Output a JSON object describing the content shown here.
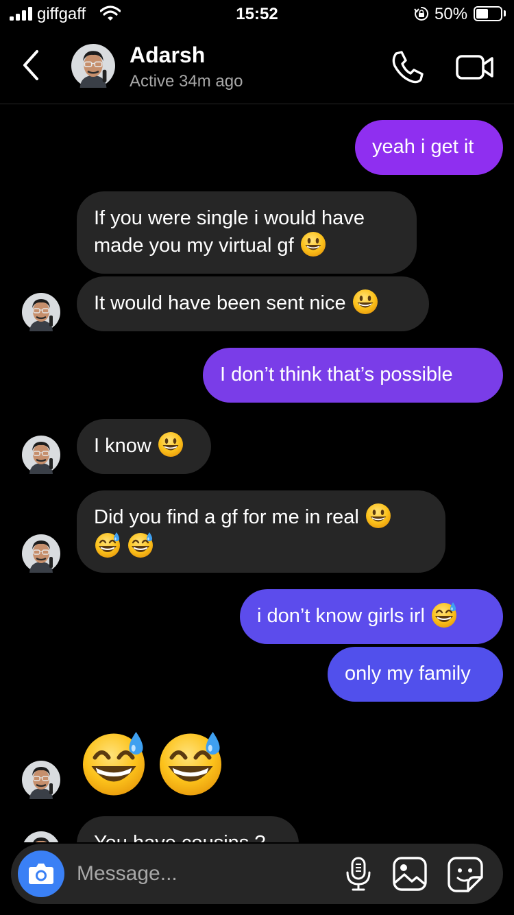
{
  "status_bar": {
    "carrier": "giffgaff",
    "time": "15:52",
    "battery_percent": "50%",
    "battery_level": 0.5,
    "icons": [
      "signal-icon",
      "wifi-icon",
      "rotation-lock-icon",
      "battery-icon"
    ]
  },
  "header": {
    "contact_name": "Adarsh",
    "contact_status": "Active 34m ago",
    "icons": [
      "back-chevron-icon",
      "avatar",
      "phone-icon",
      "video-camera-icon"
    ]
  },
  "messages": [
    {
      "sender": "me",
      "text": "yeah i get it"
    },
    {
      "sender": "them",
      "line1": "If you were single i would have",
      "line2": "made you my virtual gf",
      "emoji": [
        "grinning-face"
      ]
    },
    {
      "sender": "them",
      "text": "It would have been sent nice",
      "emoji": [
        "grinning-face"
      ]
    },
    {
      "sender": "me",
      "text": "I don’t think that’s possible"
    },
    {
      "sender": "them",
      "text": "I know",
      "emoji": [
        "grinning-face"
      ]
    },
    {
      "sender": "them",
      "line1": "Did you find a gf for me in real",
      "emoji": [
        "grinning-face",
        "grinning-face-with-sweat",
        "grinning-face-with-sweat"
      ]
    },
    {
      "sender": "me",
      "text": "i don’t know girls irl",
      "emoji": [
        "grinning-face-with-sweat"
      ]
    },
    {
      "sender": "me",
      "text": "only my family"
    },
    {
      "sender": "them",
      "emoji": [
        "grinning-face-with-sweat",
        "grinning-face-with-sweat"
      ]
    },
    {
      "sender": "them",
      "text": "You have cousins ?"
    }
  ],
  "composer": {
    "placeholder": "Message...",
    "icons": [
      "camera-icon",
      "microphone-icon",
      "gallery-icon",
      "sticker-icon"
    ]
  },
  "colors": {
    "background": "#000000",
    "incoming_bubble": "#262626",
    "outgoing_gradient": [
      "#8f2ff0",
      "#7a3de8",
      "#5c4cec",
      "#5150ec"
    ],
    "camera_button": "#3a80f5"
  }
}
